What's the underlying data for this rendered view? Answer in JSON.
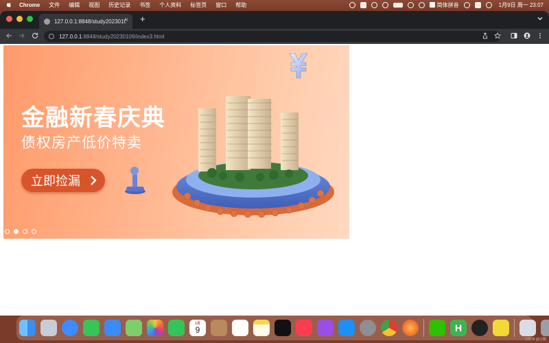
{
  "menubar": {
    "app_name": "Chrome",
    "items": [
      "文件",
      "编辑",
      "视图",
      "历史记录",
      "书签",
      "个人资料",
      "标签页",
      "窗口",
      "帮助"
    ],
    "input_method": "简体拼音",
    "clock": "1月9日 周一  23:07"
  },
  "browser": {
    "tab_title": "127.0.0.1:8848/study20230109",
    "url_host": "127.0.0.1",
    "url_path": ":8848/study20230109/index3.html"
  },
  "banner": {
    "headline": "金融新春庆典",
    "subline": "债权房产低价特卖",
    "cta_label": "立即捡漏",
    "carousel": {
      "count": 4,
      "active_index": 1
    }
  },
  "dock": {
    "calendar_month": "1月",
    "calendar_day": "9",
    "apps": [
      "finder-icon",
      "launchpad-icon",
      "safari-icon",
      "messages-icon",
      "mail-icon",
      "maps-icon",
      "photos-icon",
      "facetime-icon",
      "calendar-icon",
      "contacts-icon",
      "reminders-icon",
      "notes-icon",
      "apple-tv-icon",
      "music-icon",
      "podcasts-icon",
      "app-store-icon",
      "system-preferences-icon",
      "chrome-icon",
      "firefox-icon",
      "wechat-icon",
      "hbuilder-icon",
      "qq-icon",
      "qq-music-icon",
      "preview-icon",
      "trash-icon"
    ]
  },
  "watermark": "CSDN @小陈"
}
